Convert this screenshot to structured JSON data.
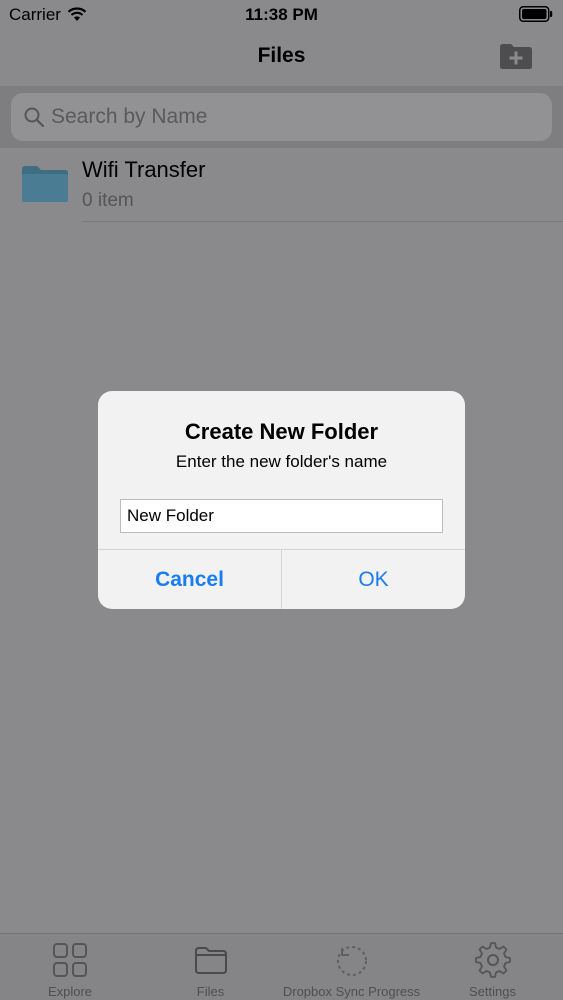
{
  "status_bar": {
    "carrier": "Carrier",
    "time": "11:38 PM"
  },
  "nav": {
    "title": "Files",
    "add_icon": "add-folder-icon"
  },
  "search": {
    "placeholder": "Search by Name"
  },
  "files": [
    {
      "name": "Wifi Transfer",
      "meta": "0 item"
    }
  ],
  "alert": {
    "title": "Create New Folder",
    "message": "Enter the new folder's name",
    "input_value": "New Folder",
    "cancel_label": "Cancel",
    "ok_label": "OK"
  },
  "tabs": [
    {
      "label": "Explore",
      "icon": "grid-icon"
    },
    {
      "label": "Files",
      "icon": "folder-icon"
    },
    {
      "label": "Dropbox Sync Progress",
      "icon": "sync-icon"
    },
    {
      "label": "Settings",
      "icon": "gear-icon"
    }
  ],
  "colors": {
    "accent": "#1a7cf2",
    "dim_overlay": "#8a8a8c",
    "dialog_bg": "#f2f2f2"
  }
}
